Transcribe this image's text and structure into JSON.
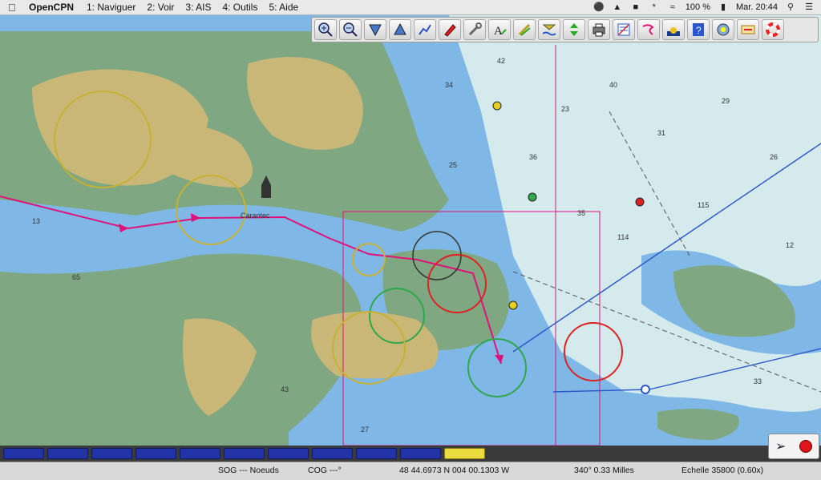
{
  "menubar": {
    "app_name": "OpenCPN",
    "menus": [
      "1: Naviguer",
      "2: Voir",
      "3: AIS",
      "4: Outils",
      "5: Aide"
    ],
    "battery": "100 %",
    "clock": "Mar. 20:44"
  },
  "toolbar": {
    "buttons": [
      "zoom-in-icon",
      "zoom-out-icon",
      "scale-down-icon",
      "scale-up-icon",
      "route-icon",
      "follow-ship-icon",
      "settings-wrench-icon",
      "text-icon",
      "pencil-tools-icon",
      "tide-icon",
      "current-icon",
      "print-icon",
      "route-manager-icon",
      "track-icon",
      "color-scheme-icon",
      "help-icon",
      "plugins-icon",
      "man-overboard-icon",
      "lifebuoy-icon"
    ]
  },
  "piano": {
    "keys": 11,
    "active_index": 10
  },
  "status": {
    "sog": "SOG --- Noeuds",
    "cog": "COG ---°",
    "position": "48 44.6973 N   004 00.1303 W",
    "bearing": "340°  0.33 Milles",
    "scale": "Echelle 35800 (0.60x)"
  },
  "chart": {
    "colors": {
      "sea_deep": "#d4eaec",
      "sea_shallow": "#7fb8e6",
      "sea_very_shallow": "#5fa0dc",
      "land": "#c9b777",
      "drying": "#7fa882",
      "route": "#e0127a",
      "track": "#2b55c8"
    },
    "label": "Carantec"
  }
}
